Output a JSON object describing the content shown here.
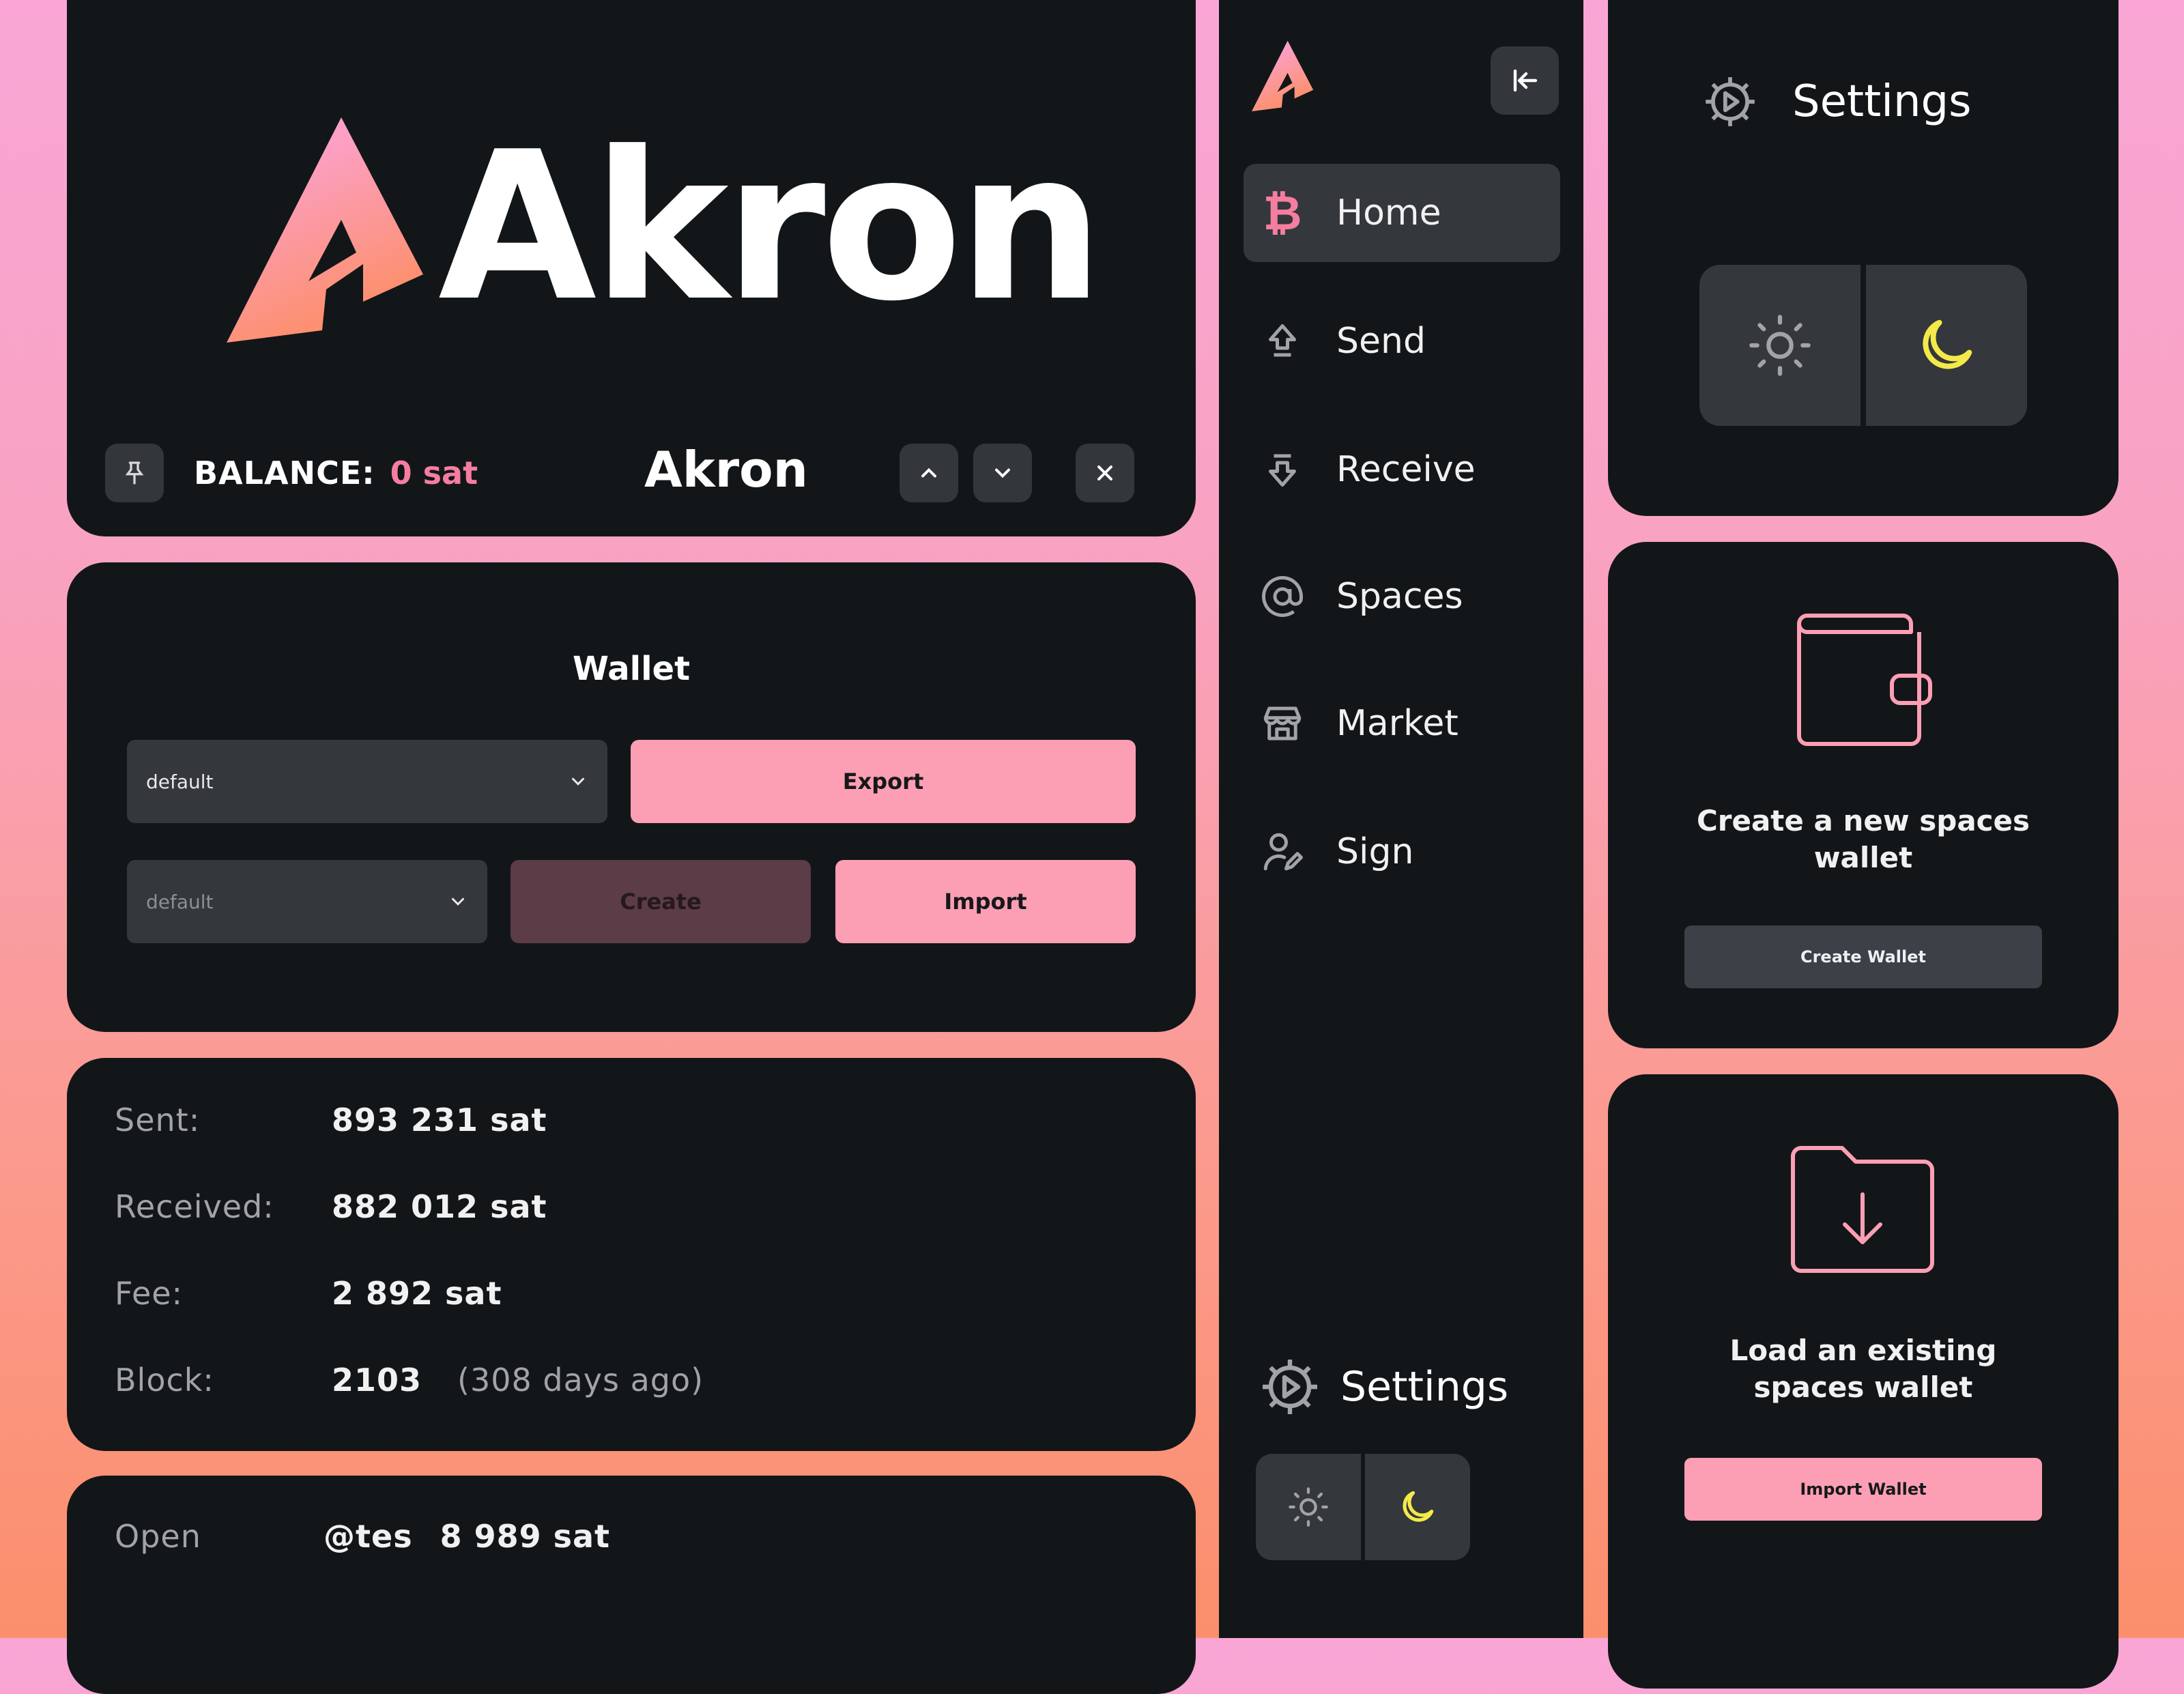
{
  "brand": {
    "name": "Akron"
  },
  "topbar": {
    "balance_label": "BALANCE:",
    "balance_value": "0 sat",
    "title": "Akron",
    "pin_icon": "pin-icon",
    "up_icon": "chevron-up-icon",
    "down_icon": "chevron-down-icon",
    "close_icon": "close-icon"
  },
  "wallet": {
    "title": "Wallet",
    "select_primary": "default",
    "select_secondary": "default",
    "export_label": "Export",
    "create_label": "Create",
    "import_label": "Import"
  },
  "stats": [
    {
      "label": "Sent:",
      "value": "893 231 sat",
      "extra": ""
    },
    {
      "label": "Received:",
      "value": "882 012 sat",
      "extra": ""
    },
    {
      "label": "Fee:",
      "value": "2 892 sat",
      "extra": ""
    },
    {
      "label": "Block:",
      "value": "2103",
      "extra": "(308 days ago)"
    }
  ],
  "open_row": {
    "label": "Open",
    "handle": "@tes",
    "value": "8 989 sat"
  },
  "sidebar": {
    "items": [
      {
        "label": "Home",
        "icon": "bitcoin-icon",
        "active": true
      },
      {
        "label": "Send",
        "icon": "send-arrow-icon"
      },
      {
        "label": "Receive",
        "icon": "receive-arrow-icon"
      },
      {
        "label": "Spaces",
        "icon": "at-icon"
      },
      {
        "label": "Market",
        "icon": "store-icon"
      },
      {
        "label": "Sign",
        "icon": "user-sign-icon"
      }
    ],
    "settings_label": "Settings"
  },
  "settings_card": {
    "title": "Settings"
  },
  "create_card": {
    "text_line1": "Create a new spaces",
    "text_line2": "wallet",
    "button": "Create Wallet"
  },
  "import_card": {
    "text_line1": "Load an existing",
    "text_line2": "spaces wallet",
    "button": "Import Wallet"
  },
  "colors": {
    "accent_pink": "#fd9fb4",
    "balance_pink": "#f57ea0",
    "moon_yellow": "#f5e94a",
    "panel": "#121619"
  }
}
